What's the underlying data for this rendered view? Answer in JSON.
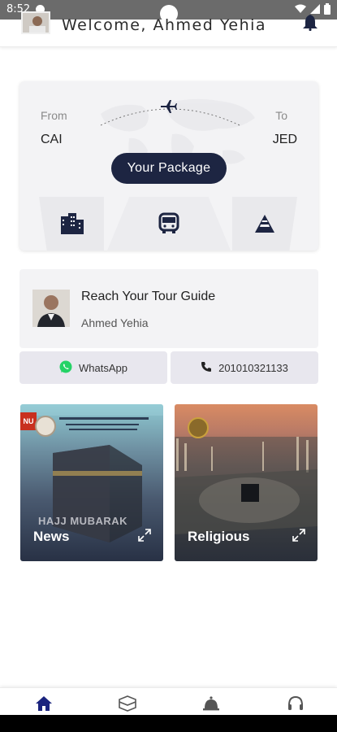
{
  "status_bar": {
    "time": "8:52"
  },
  "header": {
    "welcome_text": "Welcome, Ahmed Yehia"
  },
  "flight": {
    "from_label": "From",
    "from_code": "CAI",
    "to_label": "To",
    "to_code": "JED",
    "package_button": "Your Package"
  },
  "flight_tabs": [
    {
      "icon": "hotel-icon"
    },
    {
      "icon": "bus-icon"
    },
    {
      "icon": "pyramid-icon"
    }
  ],
  "guide": {
    "title": "Reach Your Tour Guide",
    "name": "Ahmed Yehia"
  },
  "contact": {
    "whatsapp_label": "WhatsApp",
    "phone_label": "201010321133"
  },
  "tiles": [
    {
      "label": "News",
      "overlay_text": "HAJJ MUBARAK",
      "corner_badge": "NU"
    },
    {
      "label": "Religious"
    }
  ],
  "bottom_nav": [
    {
      "icon": "home-icon",
      "active": true
    },
    {
      "icon": "kaaba-icon",
      "active": false
    },
    {
      "icon": "service-bell-icon",
      "active": false
    },
    {
      "icon": "headset-icon",
      "active": false
    }
  ],
  "colors": {
    "primary": "#1d2542",
    "card_bg": "#f3f3f5",
    "button_bg": "#e8e7ee",
    "whatsapp": "#25d366",
    "active_nav": "#1a237e"
  }
}
